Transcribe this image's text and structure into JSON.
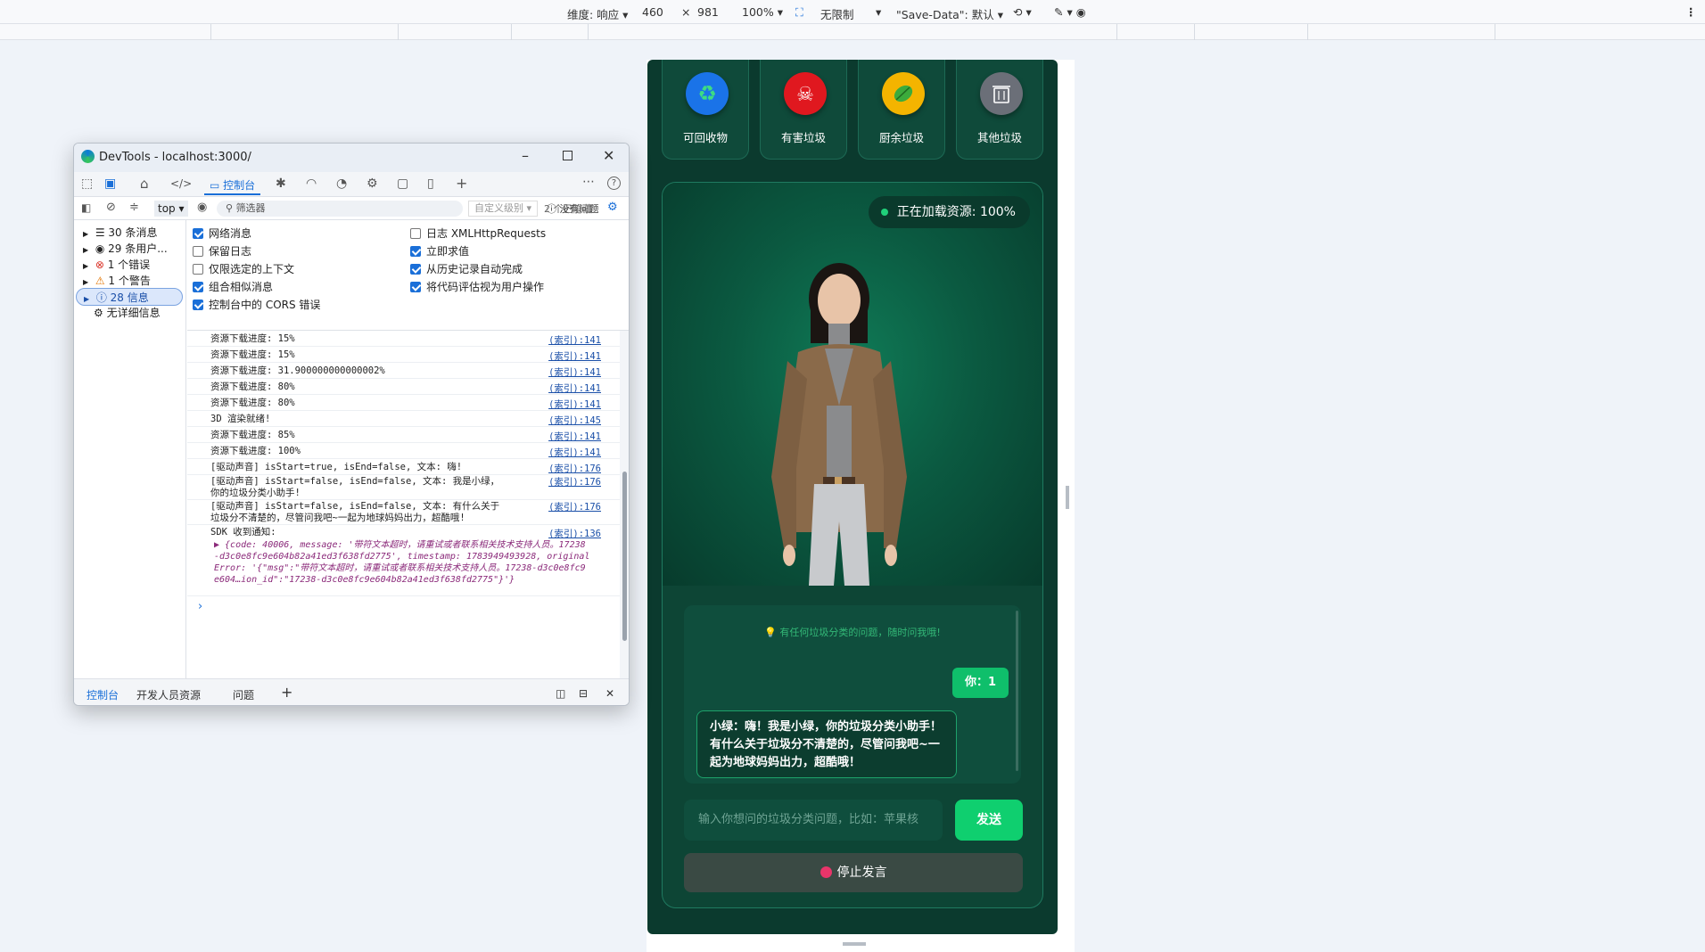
{
  "device_toolbar": {
    "dimensions_label": "维度: 响应",
    "width": "460",
    "times": "×",
    "height": "981",
    "zoom": "100%",
    "throttle": "无限制",
    "save_data": "\"Save-Data\": 默认"
  },
  "app": {
    "categories": [
      {
        "label": "可回收物",
        "color": "#1a73e8",
        "icon": "recycle-icon"
      },
      {
        "label": "有害垃圾",
        "color": "#e0181f",
        "icon": "skull-icon"
      },
      {
        "label": "厨余垃圾",
        "color": "#f4b400",
        "icon": "leaf-icon"
      },
      {
        "label": "其他垃圾",
        "color": "#6b6f78",
        "icon": "trash-icon"
      }
    ],
    "loading_status": "正在加载资源: 100%",
    "hint": "有任何垃圾分类的问题，随时问我哦!",
    "user_message": "你：1",
    "bot_message": "小绿：嗨！我是小绿，你的垃圾分类小助手！有什么关于垃圾分不清楚的，尽管问我吧~一起为地球妈妈出力，超酷哦！",
    "input_placeholder": "输入你想问的垃圾分类问题，比如：苹果核",
    "send_label": "发送",
    "stop_label": "停止发言"
  },
  "devtools": {
    "window_title": "DevTools - localhost:3000/",
    "console_tab": "控制台",
    "context": "top",
    "filter_placeholder": "筛选器",
    "levels": "自定义级别",
    "no_issues": "没有问题",
    "hidden": "2 个已隐藏",
    "sidebar": [
      {
        "label": "30 条消息",
        "arrow": "▶"
      },
      {
        "label": "29 条用户...",
        "arrow": "▶"
      },
      {
        "label": "1 个错误",
        "arrow": "▶"
      },
      {
        "label": "1 个警告",
        "arrow": "▶"
      },
      {
        "label": "28 信息",
        "arrow": "▶"
      },
      {
        "label": "无详细信息",
        "arrow": ""
      }
    ],
    "checkboxes_left": [
      {
        "label": "网络消息",
        "on": true
      },
      {
        "label": "保留日志",
        "on": false
      },
      {
        "label": "仅限选定的上下文",
        "on": false
      },
      {
        "label": "组合相似消息",
        "on": true
      },
      {
        "label": "控制台中的 CORS 错误",
        "on": true
      }
    ],
    "checkboxes_right": [
      {
        "label": "日志 XMLHttpRequests",
        "on": false
      },
      {
        "label": "立即求值",
        "on": true
      },
      {
        "label": "从历史记录自动完成",
        "on": true
      },
      {
        "label": "将代码评估视为用户操作",
        "on": true
      }
    ],
    "logs": [
      {
        "text": "资源下载进度: 15%",
        "src": "(索引):141"
      },
      {
        "text": "资源下载进度: 15%",
        "src": "(索引):141"
      },
      {
        "text": "资源下载进度: 31.900000000000002%",
        "src": "(索引):141"
      },
      {
        "text": "资源下载进度: 80%",
        "src": "(索引):141"
      },
      {
        "text": "资源下载进度: 80%",
        "src": "(索引):141"
      },
      {
        "text": "3D 渲染就绪!",
        "src": "(索引):145"
      },
      {
        "text": "资源下载进度: 85%",
        "src": "(索引):141"
      },
      {
        "text": "资源下载进度: 100%",
        "src": "(索引):141"
      },
      {
        "text": "[驱动声音] isStart=true, isEnd=false, 文本: 嗨!",
        "src": "(索引):176"
      },
      {
        "text": "[驱动声音] isStart=false, isEnd=false, 文本: 我是小绿，\n你的垃圾分类小助手!",
        "src": "(索引):176"
      },
      {
        "text": "[驱动声音] isStart=false, isEnd=false, 文本: 有什么关于\n垃圾分不清楚的，尽管问我吧~一起为地球妈妈出力，超酷哦!",
        "src": "(索引):176"
      },
      {
        "text": "SDK 收到通知:",
        "src": "(索引):136"
      }
    ],
    "sdk_object": "▶ {code: 40006, message: '带符文本超时，请重试或者联系相关技术支持人员。17238-d3c0e8fc9e604b82a41ed3f638fd2775', timestamp: 1783949493928, originalError: '{\"msg\":\"带符文本超时，请重试或者联系相关技术支持人员。17238-d3c0e8fc9e604…ion_id\":\"17238-d3c0e8fc9e604b82a41ed3f638fd2775\"}'}",
    "prompt": "›",
    "bottom_tabs": [
      "控制台",
      "开发人员资源",
      "问题"
    ]
  }
}
